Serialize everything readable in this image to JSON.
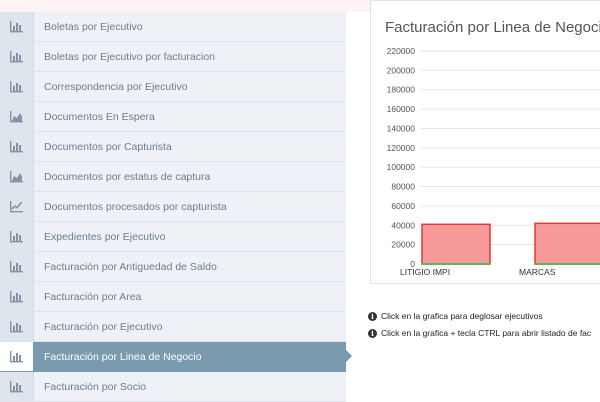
{
  "sidebar": {
    "items": [
      {
        "label": "Boletas por Ejecutivo",
        "icon": "bar-chart-icon",
        "active": false
      },
      {
        "label": "Boletas por Ejecutivo por facturacion",
        "icon": "bar-chart-icon",
        "active": false
      },
      {
        "label": "Correspondencia por Ejecutivo",
        "icon": "bar-chart-icon",
        "active": false
      },
      {
        "label": "Documentos En Espera",
        "icon": "area-chart-icon",
        "active": false
      },
      {
        "label": "Documentos por Capturista",
        "icon": "bar-chart-icon",
        "active": false
      },
      {
        "label": "Documentos por estatus de captura",
        "icon": "area-chart-icon",
        "active": false
      },
      {
        "label": "Documentos procesados por capturista",
        "icon": "line-chart-icon",
        "active": false
      },
      {
        "label": "Expedientes por Ejecutivo",
        "icon": "bar-chart-icon",
        "active": false
      },
      {
        "label": "Facturación por Antiguedad de Saldo",
        "icon": "bar-chart-icon",
        "active": false
      },
      {
        "label": "Facturación por Area",
        "icon": "bar-chart-icon",
        "active": false
      },
      {
        "label": "Facturación por Ejecutivo",
        "icon": "bar-chart-icon",
        "active": false
      },
      {
        "label": "Facturación por Linea de Negocio",
        "icon": "bar-chart-icon",
        "active": true
      },
      {
        "label": "Facturación por Socio",
        "icon": "bar-chart-icon",
        "active": false
      }
    ]
  },
  "chart_data": {
    "type": "bar",
    "title": "Facturación por Linea de Negocio:",
    "categories": [
      "LITIGIO IMPI",
      "MARCAS"
    ],
    "series": [
      {
        "values": [
          41000,
          42000
        ]
      }
    ],
    "ylim": [
      0,
      220000
    ],
    "yticks": [
      "220000",
      "200000",
      "180000",
      "160000",
      "140000",
      "120000",
      "100000",
      "80000",
      "60000",
      "40000",
      "20000",
      "0"
    ],
    "grid": true,
    "colors": {
      "bar_fill": "#f99a9a",
      "bar_stroke": "#e53935",
      "baseline": "#5cb85c",
      "grid": "#e6e6e6"
    }
  },
  "notes": [
    {
      "icon": "info-icon",
      "text": "Click en la grafica para deglosar ejecutivos"
    },
    {
      "icon": "info-icon",
      "text": "Click en la grafica + tecla CTRL para abrir listado de fac"
    }
  ],
  "colors": {
    "active_item": "#7a9ab0",
    "sidebar_bg": "#eef1f5",
    "label_text": "#6d7e91"
  }
}
